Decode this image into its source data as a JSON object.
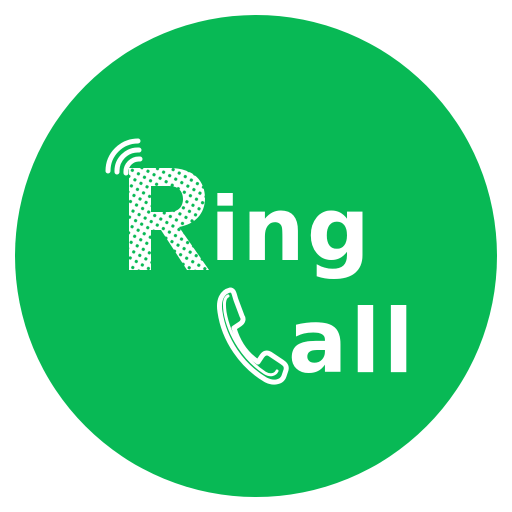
{
  "logo": {
    "ring_initial": "R",
    "ring_rest": "ing",
    "call_initial": "C",
    "call_rest": "all"
  },
  "colors": {
    "background": "#08b955",
    "foreground": "#ffffff"
  },
  "icons": [
    "wifi-signal-icon",
    "phone-handset-icon"
  ]
}
